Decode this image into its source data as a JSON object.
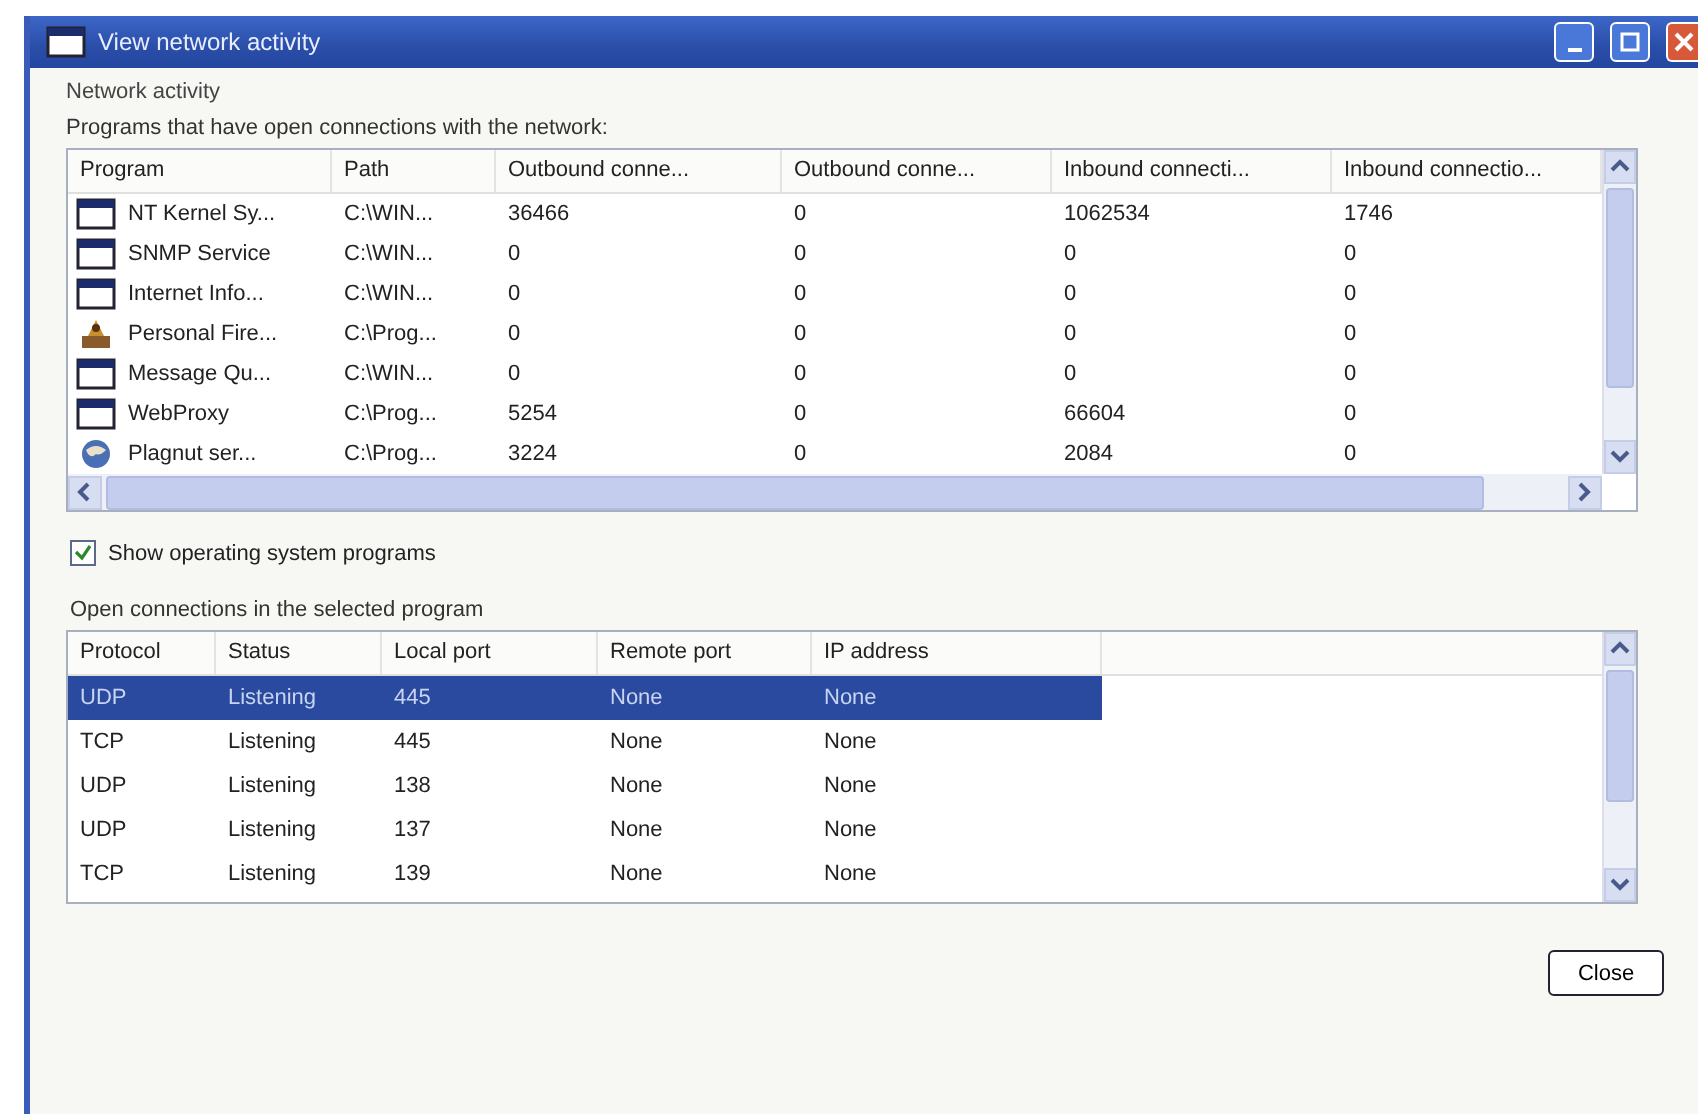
{
  "window": {
    "title": "View network activity"
  },
  "group_label": "Network activity",
  "programs_caption": "Programs that have open connections with the network:",
  "programs_table": {
    "columns": [
      "Program",
      "Path",
      "Outbound conne...",
      "Outbound conne...",
      "Inbound connecti...",
      "Inbound connectio..."
    ],
    "rows": [
      {
        "kind": "window",
        "cells": [
          "NT Kernel Sy...",
          "C:\\WIN...",
          "36466",
          "0",
          "1062534",
          "1746"
        ]
      },
      {
        "kind": "window",
        "cells": [
          "SNMP Service",
          "C:\\WIN...",
          "0",
          "0",
          "0",
          "0"
        ]
      },
      {
        "kind": "window",
        "cells": [
          "Internet Info...",
          "C:\\WIN...",
          "0",
          "0",
          "0",
          "0"
        ]
      },
      {
        "kind": "firewall",
        "cells": [
          "Personal Fire...",
          "C:\\Prog...",
          "0",
          "0",
          "0",
          "0"
        ]
      },
      {
        "kind": "window",
        "cells": [
          "Message Qu...",
          "C:\\WIN...",
          "0",
          "0",
          "0",
          "0"
        ]
      },
      {
        "kind": "window",
        "cells": [
          "WebProxy",
          "C:\\Prog...",
          "5254",
          "0",
          "66604",
          "0"
        ]
      },
      {
        "kind": "globe",
        "cells": [
          "Plagnut ser...",
          "C:\\Prog...",
          "3224",
          "0",
          "2084",
          "0"
        ]
      }
    ]
  },
  "show_os_programs": {
    "label": "Show operating system programs",
    "checked": true
  },
  "connections_caption": "Open connections in the selected program",
  "connections_table": {
    "columns": [
      "Protocol",
      "Status",
      "Local port",
      "Remote port",
      "IP address"
    ],
    "rows": [
      {
        "selected": true,
        "cells": [
          "UDP",
          "Listening",
          "445",
          "None",
          "None"
        ]
      },
      {
        "selected": false,
        "cells": [
          "TCP",
          "Listening",
          "445",
          "None",
          "None"
        ]
      },
      {
        "selected": false,
        "cells": [
          "UDP",
          "Listening",
          "138",
          "None",
          "None"
        ]
      },
      {
        "selected": false,
        "cells": [
          "UDP",
          "Listening",
          "137",
          "None",
          "None"
        ]
      },
      {
        "selected": false,
        "cells": [
          "TCP",
          "Listening",
          "139",
          "None",
          "None"
        ]
      }
    ]
  },
  "buttons": [
    "Close"
  ]
}
